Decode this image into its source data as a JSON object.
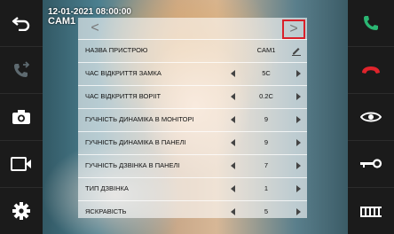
{
  "status": {
    "datetime": "12-01-2021  08:00:00",
    "camera": "CAM1"
  },
  "left_sidebar": {
    "buttons": [
      {
        "icon": "back-arrow-icon",
        "color": "#ffffff"
      },
      {
        "icon": "call-transfer-icon",
        "color": "#5e6a70"
      },
      {
        "icon": "camera-icon",
        "color": "#ffffff"
      },
      {
        "icon": "video-record-icon",
        "color": "#ffffff"
      },
      {
        "icon": "settings-gear-icon",
        "color": "#ffffff"
      }
    ]
  },
  "right_sidebar": {
    "buttons": [
      {
        "icon": "answer-call-icon",
        "color": "#2bb673"
      },
      {
        "icon": "hang-up-icon",
        "color": "#e0242c"
      },
      {
        "icon": "monitor-eye-icon",
        "color": "#ffffff"
      },
      {
        "icon": "unlock-key-icon",
        "color": "#ffffff"
      },
      {
        "icon": "gate-icon",
        "color": "#ffffff"
      }
    ]
  },
  "settings": {
    "nav": {
      "prev": "<",
      "next": ">"
    },
    "highlight_color": "#d9202a",
    "rows": [
      {
        "label": "НАЗВА ПРИСТРОЮ",
        "value": "CAM1",
        "editable": true
      },
      {
        "label": "ЧАС ВІДКРИТТЯ ЗАМКА",
        "value": "5C"
      },
      {
        "label": "ЧАС ВІДКРИТТЯ ВОРІІТ",
        "value": "0.2C"
      },
      {
        "label": "ГУЧНІСТЬ ДИНАМІКА В МОНІТОРІ",
        "value": "9"
      },
      {
        "label": "ГУЧНІСТЬ ДИНАМІКА В ПАНЕЛІ",
        "value": "9"
      },
      {
        "label": "ГУЧНІСТЬ ДЗВІНКА В ПАНЕЛІ",
        "value": "7"
      },
      {
        "label": "ТИП ДЗВІНКА",
        "value": "1"
      },
      {
        "label": "ЯСКРАВІСТЬ",
        "value": "5"
      }
    ]
  }
}
